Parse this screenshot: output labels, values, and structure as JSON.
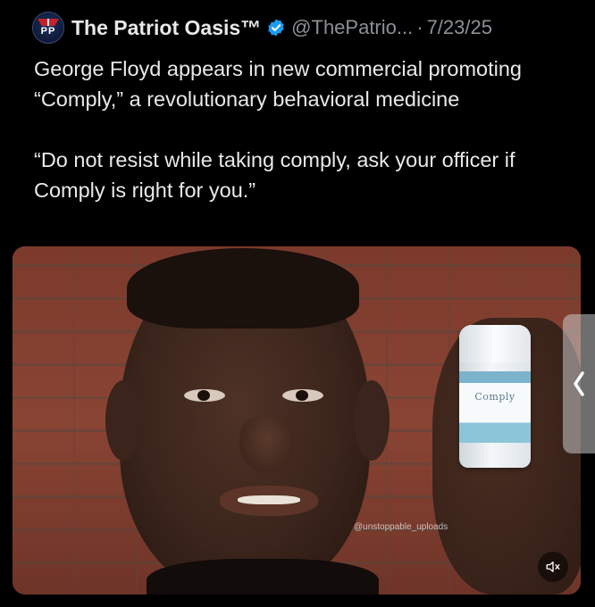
{
  "post": {
    "display_name": "The Patriot Oasis™",
    "handle": "@ThePatrio...",
    "separator": "·",
    "date": "7/23/25",
    "text_paragraphs": [
      "George Floyd appears in new commercial promoting “Comply,” a revolutionary behavioral medicine",
      "“Do not resist while taking comply, ask your officer if Comply is right for you.”"
    ],
    "avatar_text": "PP"
  },
  "media": {
    "bottle_label": "Comply",
    "watermark": "@unstoppable_uploads"
  },
  "icons": {
    "verified": "verified-badge-icon",
    "mute": "speaker-muted-icon",
    "side_handle": "chevron-left-icon"
  },
  "colors": {
    "background": "#000000",
    "text": "#e7e9ea",
    "secondary_text": "#8b9196",
    "verified_blue": "#1d9bf0"
  }
}
